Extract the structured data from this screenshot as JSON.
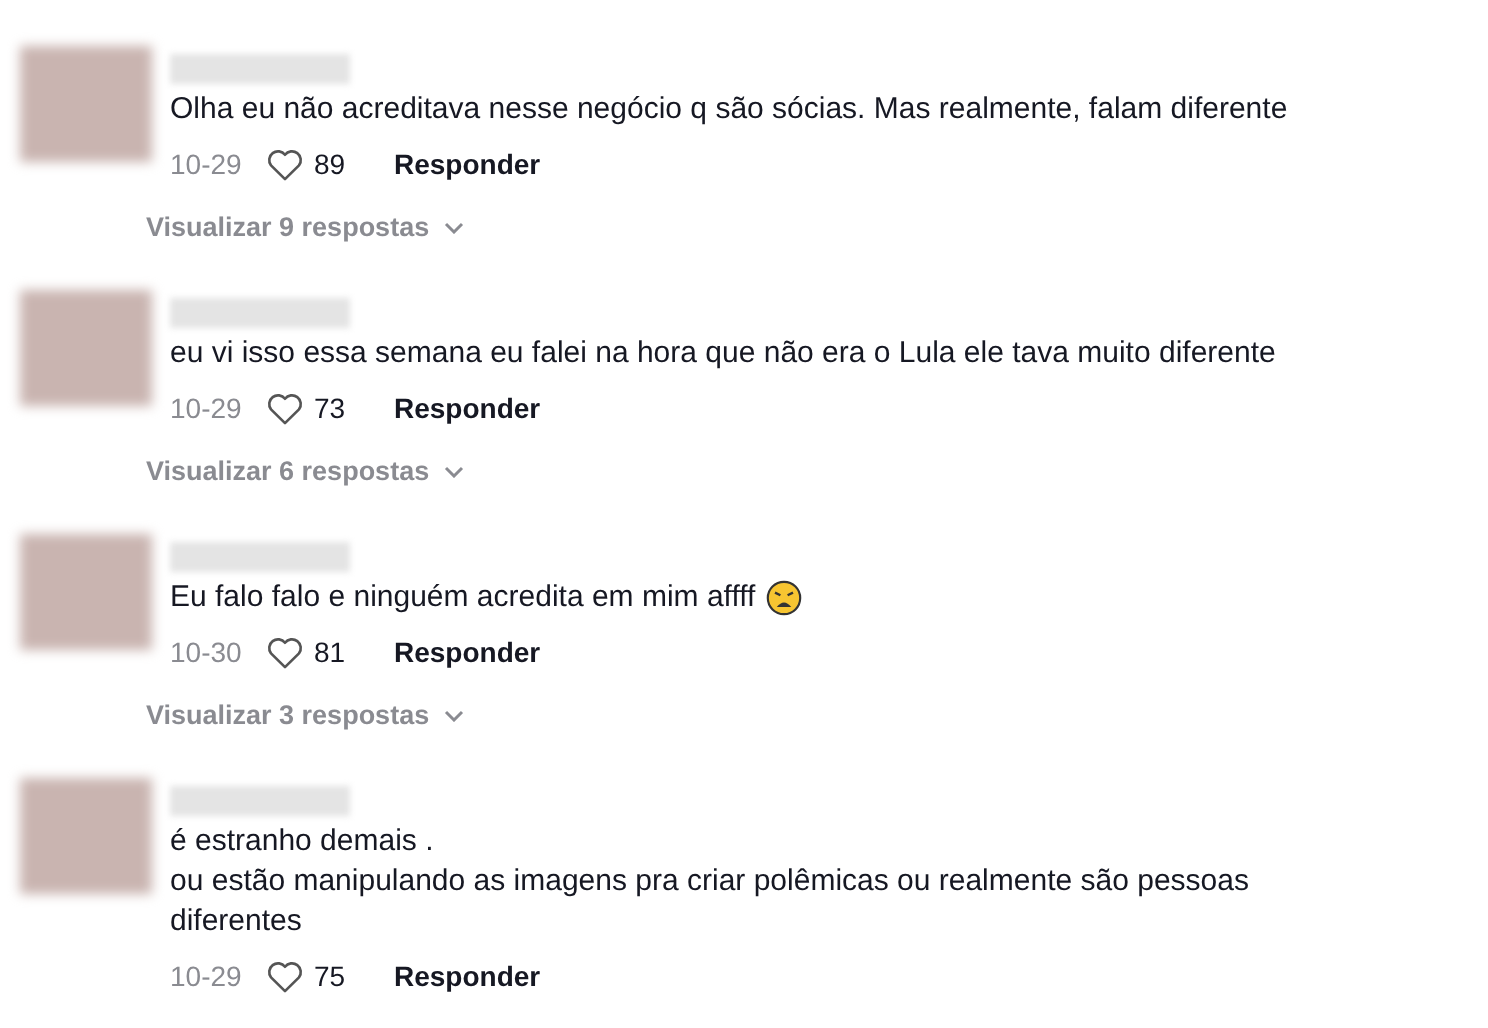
{
  "comments": [
    {
      "text": "Olha eu não acreditava nesse negócio q são sócias. Mas realmente, falam diferente",
      "emoji": false,
      "date": "10-29",
      "likes": "89",
      "reply": "Responder",
      "replies": "Visualizar 9 respostas"
    },
    {
      "text": "eu vi isso essa semana eu falei na hora que não era o Lula ele tava muito diferente",
      "emoji": false,
      "date": "10-29",
      "likes": "73",
      "reply": "Responder",
      "replies": "Visualizar 6 respostas"
    },
    {
      "text": "Eu falo falo e ninguém acredita em mim affff",
      "emoji": true,
      "date": "10-30",
      "likes": "81",
      "reply": "Responder",
      "replies": "Visualizar 3 respostas"
    },
    {
      "text": "é estranho demais .\nou estão manipulando as imagens pra criar polêmicas ou realmente são pessoas diferentes",
      "emoji": false,
      "date": "10-29",
      "likes": "75",
      "reply": "Responder"
    }
  ]
}
